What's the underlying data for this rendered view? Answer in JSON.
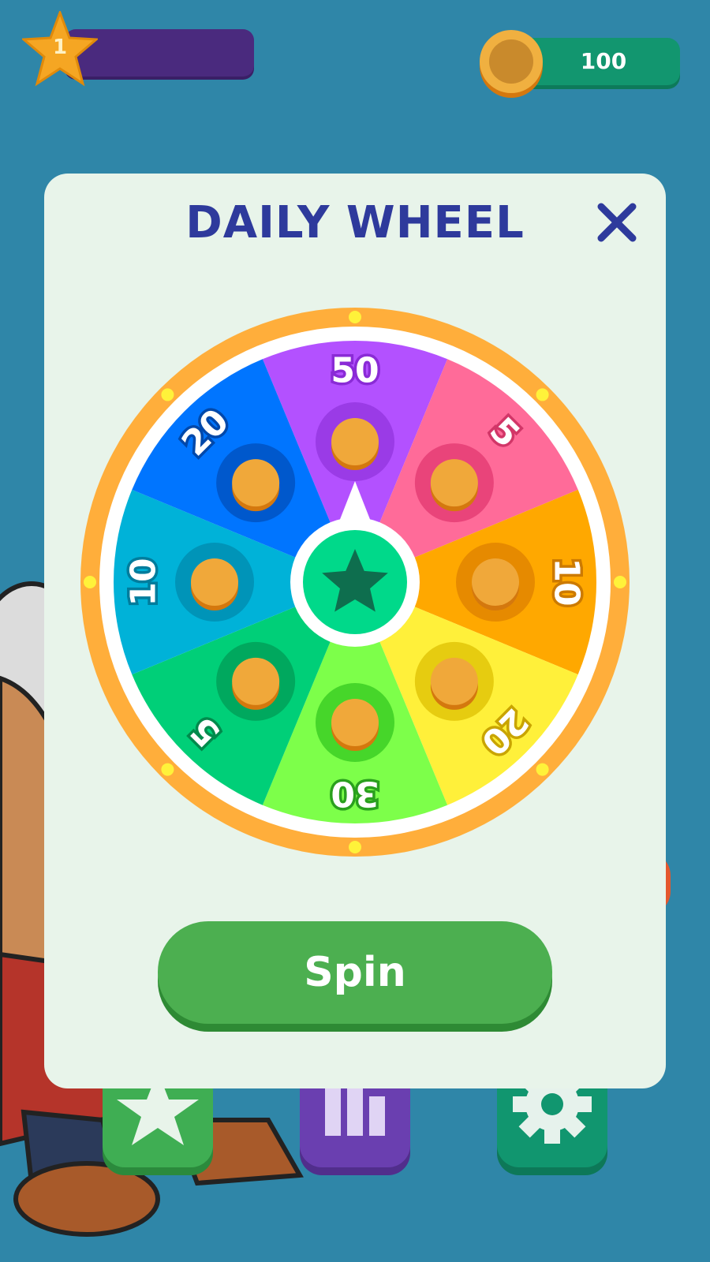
{
  "hud": {
    "level": "1",
    "coins": "100"
  },
  "modal": {
    "title": "DAILY WHEEL",
    "spin_label": "Spin"
  },
  "wheel": {
    "segments": [
      {
        "value": "50",
        "color": "#b351ff",
        "dark": "#9a3be6",
        "text_stroke": "#8a2bd6"
      },
      {
        "value": "5",
        "color": "#ff6b99",
        "dark": "#e9447a",
        "text_stroke": "#d23668"
      },
      {
        "value": "10",
        "color": "#ffa800",
        "dark": "#e68a00",
        "text_stroke": "#cc7a00"
      },
      {
        "value": "20",
        "color": "#fff03a",
        "dark": "#e6cc10",
        "text_stroke": "#c9a400"
      },
      {
        "value": "30",
        "color": "#7dff4a",
        "dark": "#46d62a",
        "text_stroke": "#2aa01e"
      },
      {
        "value": "5",
        "color": "#00cf78",
        "dark": "#00a85e",
        "text_stroke": "#008a4c"
      },
      {
        "value": "10",
        "color": "#00b2d8",
        "dark": "#0094b8",
        "text_stroke": "#007c9c"
      },
      {
        "value": "20",
        "color": "#0075ff",
        "dark": "#0058cc",
        "text_stroke": "#0048aa"
      }
    ],
    "rim_color": "#ffae3b",
    "hub_color": "#00d98a"
  }
}
